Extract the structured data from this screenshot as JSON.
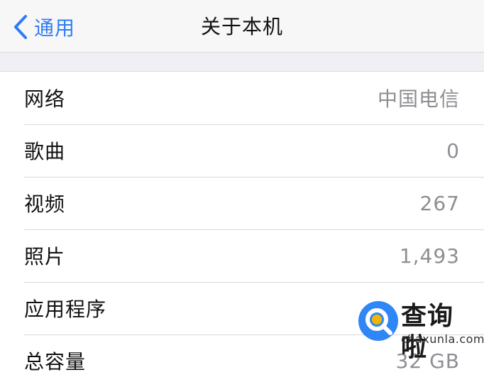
{
  "navbar": {
    "back_label": "通用",
    "title": "关于本机",
    "back_icon": "chevron-left-icon"
  },
  "rows": [
    {
      "label": "网络",
      "value": "中国电信"
    },
    {
      "label": "歌曲",
      "value": "0"
    },
    {
      "label": "视频",
      "value": "267"
    },
    {
      "label": "照片",
      "value": "1,493"
    },
    {
      "label": "应用程序",
      "value": ""
    },
    {
      "label": "总容量",
      "value": "32 GB"
    }
  ],
  "watermark": {
    "text": "查询啦",
    "subtext": "chaxunla.com"
  },
  "colors": {
    "accent": "#2f7cf6",
    "value_gray": "#8e8e93",
    "background": "#efeff4",
    "watermark_blue": "#2f86f6"
  }
}
